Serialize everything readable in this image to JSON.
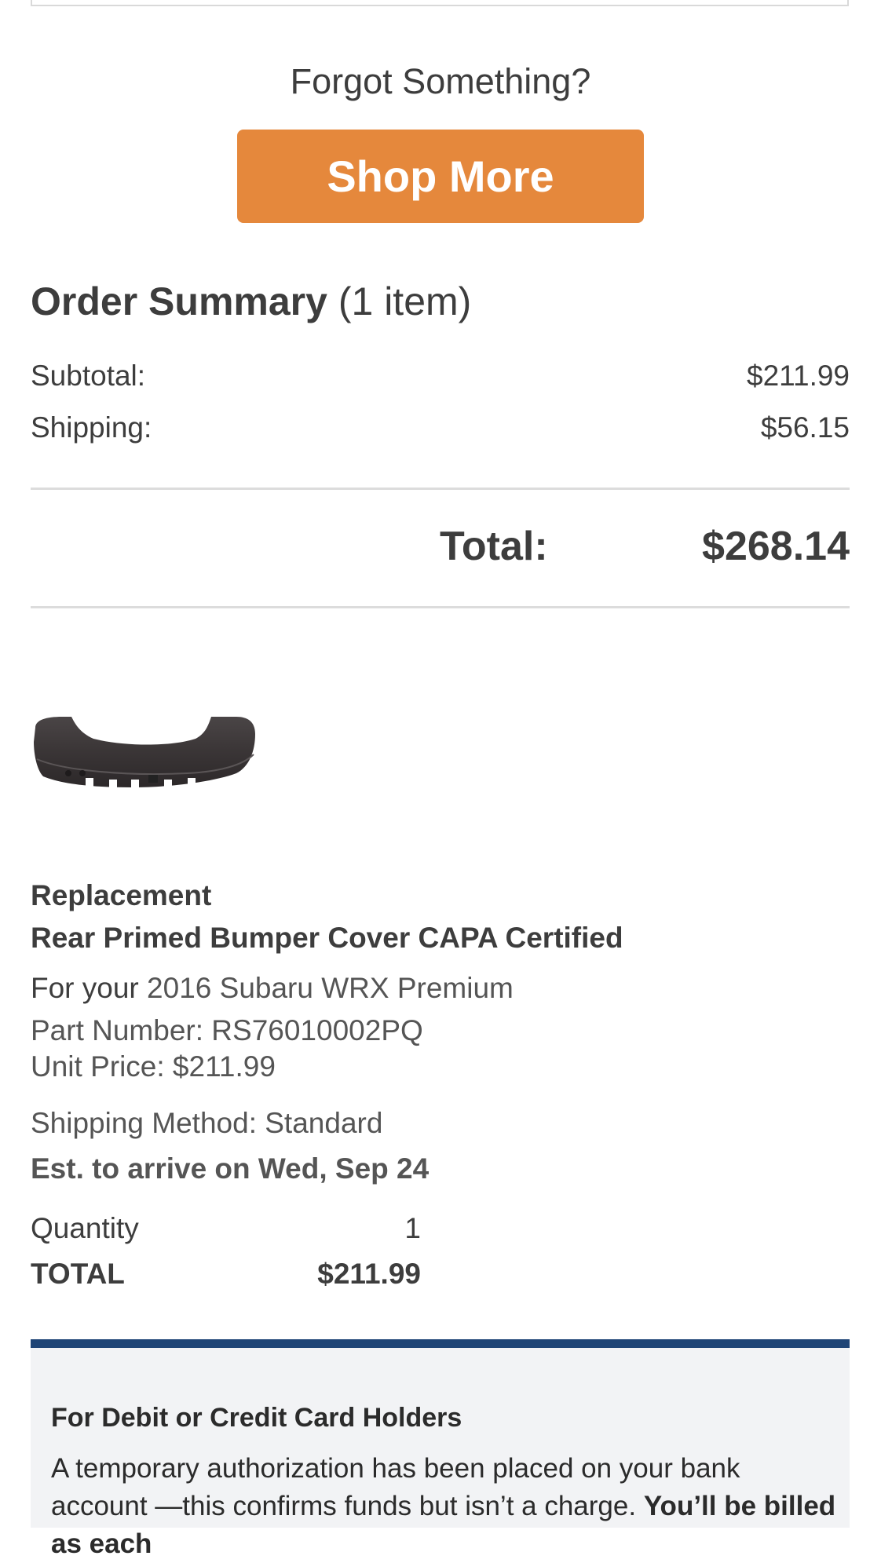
{
  "forgot_text": "Forgot Something?",
  "shop_more_label": "Shop More",
  "accent_color": "#e5883c",
  "order_summary": {
    "title": "Order Summary",
    "count_text": "(1 item)",
    "subtotal_label": "Subtotal:",
    "subtotal_value": "$211.99",
    "shipping_label": "Shipping:",
    "shipping_value": "$56.15",
    "total_label": "Total:",
    "total_value": "$268.14"
  },
  "item": {
    "image_icon": "rear-bumper-image",
    "line1": "Replacement",
    "line2": "Rear Primed Bumper Cover CAPA Certified",
    "vehicle_prefix": "For your ",
    "vehicle_name": "2016 Subaru WRX Premium",
    "part_number": "Part Number: RS76010002PQ",
    "unit_price": "Unit Price: $211.99",
    "shipping_method": "Shipping Method: Standard",
    "arrival": "Est. to arrive on Wed, Sep 24",
    "quantity_label": "Quantity",
    "quantity_value": "1",
    "total_label": "TOTAL",
    "total_value": "$211.99"
  },
  "card_notice": {
    "border_color": "#1f4576",
    "title": "For Debit or Credit Card Holders",
    "body_text": "A temporary authorization has been placed on your bank account —this confirms funds but isn’t a charge. ",
    "body_bold": "You’ll be billed as each"
  }
}
